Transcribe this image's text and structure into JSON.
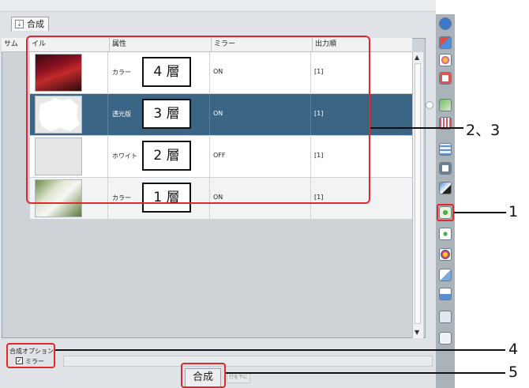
{
  "tab": {
    "label": "合成"
  },
  "table": {
    "headers": [
      "サム",
      "イル",
      "属性",
      "ミラー",
      "出力順"
    ],
    "rows": [
      {
        "attribute": "カラー",
        "layer": "4 層",
        "mirror": "ON",
        "order": "[1]",
        "selected": false
      },
      {
        "attribute": "透光版",
        "layer": "3 層",
        "mirror": "ON",
        "order": "[1]",
        "selected": true
      },
      {
        "attribute": "ホワイト",
        "layer": "2 層",
        "mirror": "OFF",
        "order": "[1]",
        "selected": false
      },
      {
        "attribute": "カラー",
        "layer": "1 層",
        "mirror": "ON",
        "order": "[1]",
        "selected": false
      }
    ]
  },
  "options": {
    "title": "合成オプション",
    "mirror_label": "ミラー",
    "mirror_checked": true
  },
  "buttons": {
    "compose": "合成",
    "secondary": "行を下に"
  },
  "callouts": [
    "2、3",
    "1",
    "4",
    "5"
  ],
  "colors": {
    "highlight": "#e02a2a",
    "selected_row": "#3a6585",
    "toolbar": "#aab2ba"
  },
  "toolbar_icons": [
    "help-icon",
    "layer-copy-icon",
    "color-icon",
    "red-square-icon",
    "image-icon",
    "bars-icon",
    "grid-icon",
    "frame-icon",
    "star-icon",
    "compose-icon",
    "arrange-icon",
    "target-icon",
    "duplicate-icon",
    "split-icon",
    "trash-icon",
    "question-icon"
  ]
}
